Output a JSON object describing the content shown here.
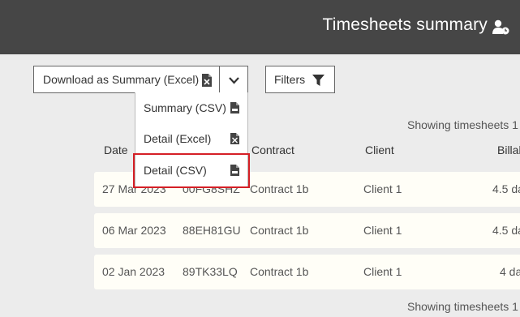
{
  "header": {
    "title": "Timesheets summary",
    "icon": "user-clock-icon"
  },
  "toolbar": {
    "download_label": "Download as Summary (Excel)",
    "download_icon": "excel-file-icon",
    "caret_icon": "chevron-down-icon",
    "filters_label": "Filters",
    "filters_icon": "filter-icon"
  },
  "dropdown": {
    "items": [
      {
        "label": "Summary (CSV)",
        "icon": "csv-file-icon"
      },
      {
        "label": "Detail (Excel)",
        "icon": "excel-file-icon"
      },
      {
        "label": "Detail (CSV)",
        "icon": "csv-file-icon"
      }
    ],
    "highlighted_index": 2
  },
  "table": {
    "showing_top": "Showing timesheets 1",
    "showing_bottom": "Showing timesheets 1",
    "columns": [
      "Date",
      "Contract",
      "Client",
      "Billab"
    ],
    "rows": [
      {
        "date": "27 Mar 2023",
        "ref": "00FG8SHZ",
        "contract": "Contract 1b",
        "client": "Client 1",
        "billable": "4.5 da"
      },
      {
        "date": "06 Mar 2023",
        "ref": "88EH81GU",
        "contract": "Contract 1b",
        "client": "Client 1",
        "billable": "4.5 da"
      },
      {
        "date": "02 Jan 2023",
        "ref": "89TK33LQ",
        "contract": "Contract 1b",
        "client": "Client 1",
        "billable": "4 da"
      }
    ]
  },
  "colors": {
    "header_bg": "#464646",
    "page_bg": "#ececec",
    "row_bg": "#fffef7",
    "highlight": "#d51f26"
  }
}
